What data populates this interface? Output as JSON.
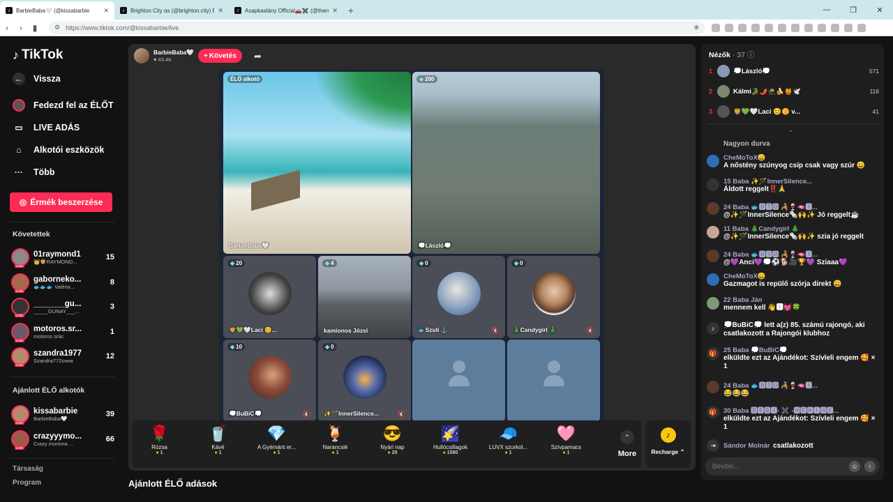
{
  "browser": {
    "tabs": [
      {
        "title": "BarbieBaba🤍 (@kissabarbie"
      },
      {
        "title": "Brighton City ɑs (@brighton.city) ÉLŐ"
      },
      {
        "title": "Asapkaslány Official🚗✖️ (@theresi"
      }
    ],
    "url": "https://www.tiktok.com/@kissabarbie/live"
  },
  "sidebar": {
    "logo": "TikTok",
    "nav": [
      {
        "label": "Vissza"
      },
      {
        "label": "Fedezd fel az ÉLŐT"
      },
      {
        "label": "LIVE ADÁS"
      },
      {
        "label": "Alkotói eszközök"
      },
      {
        "label": "Több"
      }
    ],
    "coins_button": "Érmék beszerzése",
    "following_title": "Követettek",
    "following": [
      {
        "name": "01raymond1",
        "sub": "👑🦁RAYMOND...",
        "count": "15"
      },
      {
        "name": "gaborneko...",
        "sub": "🐟🐟🐟 Valéria...",
        "count": "8"
      },
      {
        "name": "_______gu...",
        "sub": "_____GUNAY___...",
        "count": "3"
      },
      {
        "name": "motoros.sr...",
        "sub": "motoros srác",
        "count": "1"
      },
      {
        "name": "szandra1977",
        "sub": "Szandra772снни",
        "count": "12"
      }
    ],
    "recommended_title": "Ajánlott ÉLŐ alkotók",
    "recommended": [
      {
        "name": "kissabarbie",
        "sub": "BarbieBaba🤍",
        "count": "39"
      },
      {
        "name": "crazyyymo...",
        "sub": "Crazy momma ...",
        "count": "66"
      }
    ],
    "footer": [
      "Társaság",
      "Program"
    ]
  },
  "stream": {
    "host_name": "BarbieBaba🤍",
    "host_likes": "♥ 43.4K",
    "follow_label": "Követés",
    "cells": [
      {
        "badge": "ÉLŐ alkotó",
        "name": "BarbieBaba🤍"
      },
      {
        "badge": "200",
        "name": "💭László💭"
      },
      {
        "badge": "20",
        "name": "🦁💚🤍Laci 😊..."
      },
      {
        "badge": "4",
        "name": "kamionos Józsi"
      },
      {
        "badge": "0",
        "name": "🐟Szuli ⚓"
      },
      {
        "badge": "0",
        "name": "🎄Candygirl 🎄"
      },
      {
        "badge": "10",
        "name": "💭BuBiC💭"
      },
      {
        "badge": "0",
        "name": "✨🪄InnerSilence..."
      }
    ],
    "gifts": [
      {
        "name": "Rózsa",
        "price": "1",
        "icon": "🌹"
      },
      {
        "name": "Kávé",
        "price": "1",
        "icon": "🥤"
      },
      {
        "name": "A Gyémánt er...",
        "price": "1",
        "icon": "💎"
      },
      {
        "name": "Narancslé",
        "price": "1",
        "icon": "🍹"
      },
      {
        "name": "Nyári nap",
        "price": "20",
        "icon": "😎"
      },
      {
        "name": "Hullócsillagok",
        "price": "1580",
        "icon": "🌠"
      },
      {
        "name": "LUVX szurkol...",
        "price": "1",
        "icon": "🧢"
      },
      {
        "name": "Szívpamacs",
        "price": "1",
        "icon": "🩷"
      }
    ],
    "more_label": "More",
    "recharge_label": "Recharge",
    "recommended_lives": "Ajánlott ÉLŐ adások"
  },
  "chat": {
    "viewers_label": "Nézők",
    "viewers_count": "· 37",
    "top_viewers": [
      {
        "rank": "1",
        "name": "💭László💭",
        "score": "571"
      },
      {
        "rank": "2",
        "name": "Kálmi🐊🌶️🥷🍌🍯🕊️",
        "score": "116"
      },
      {
        "rank": "3",
        "name": "🦁💚🤍Laci 😊🌼 v...",
        "score": "41"
      }
    ],
    "messages": [
      {
        "user": "",
        "text": "Nagyon durva"
      },
      {
        "user": "CheMoToX😀",
        "text": "A nőstény szúnyog csíp csak vagy szúr 😀"
      },
      {
        "user": "15 Baba ✨🪄InnerSilence...",
        "text": "Áldott reggelt‼️🙏"
      },
      {
        "user": "24 Baba 🐟🅳🆃🅾 🦂🍷🫦🅸...",
        "text": "@✨🪄InnerSilence🗞️🙌✨ Jó reggelt☕"
      },
      {
        "user": "11 Baba 🎄Candygirl 🎄",
        "text": "@✨🪄InnerSilence🗞️🙌✨ szia jó reggelt"
      },
      {
        "user": "24 Baba 🐟🅳🆃🅾 🦂🍷🫦🅸...",
        "text": "@💜Anci💜💭⚽🐕🎥🏆💜 Sziaaa💜"
      },
      {
        "user": "CheMoToX😀",
        "text": "Gazmagot is repülő szórja direkt 😀"
      },
      {
        "user": "22 Baba Ján",
        "text": "mennem kell 👋🅸💓🍀"
      },
      {
        "user": "",
        "text": "💭BuBiC💭 lett a(z) 85. számú rajongó, aki csatlakozott a Rajongói klubhoz"
      },
      {
        "user": "25 Baba 💭BuBiC💭",
        "text": "elküldte ezt az Ajándékot: Szívleli engem 🥰 × 1"
      },
      {
        "user": "24 Baba 🐟🅳🆃🅾 🦂🍷🫦🅸...",
        "text": "😂😂😂"
      },
      {
        "user": "30 Baba 🅱🅴🅱🅸- ✖️ -🅽🅴🅺🅸🅽🅴...",
        "text": "elküldte ezt az Ajándékot: Szívleli engem 🥰 × 1"
      },
      {
        "user": "Sándor Molnár",
        "text": "csatlakozott"
      }
    ],
    "input_placeholder": "Bevitel..."
  }
}
